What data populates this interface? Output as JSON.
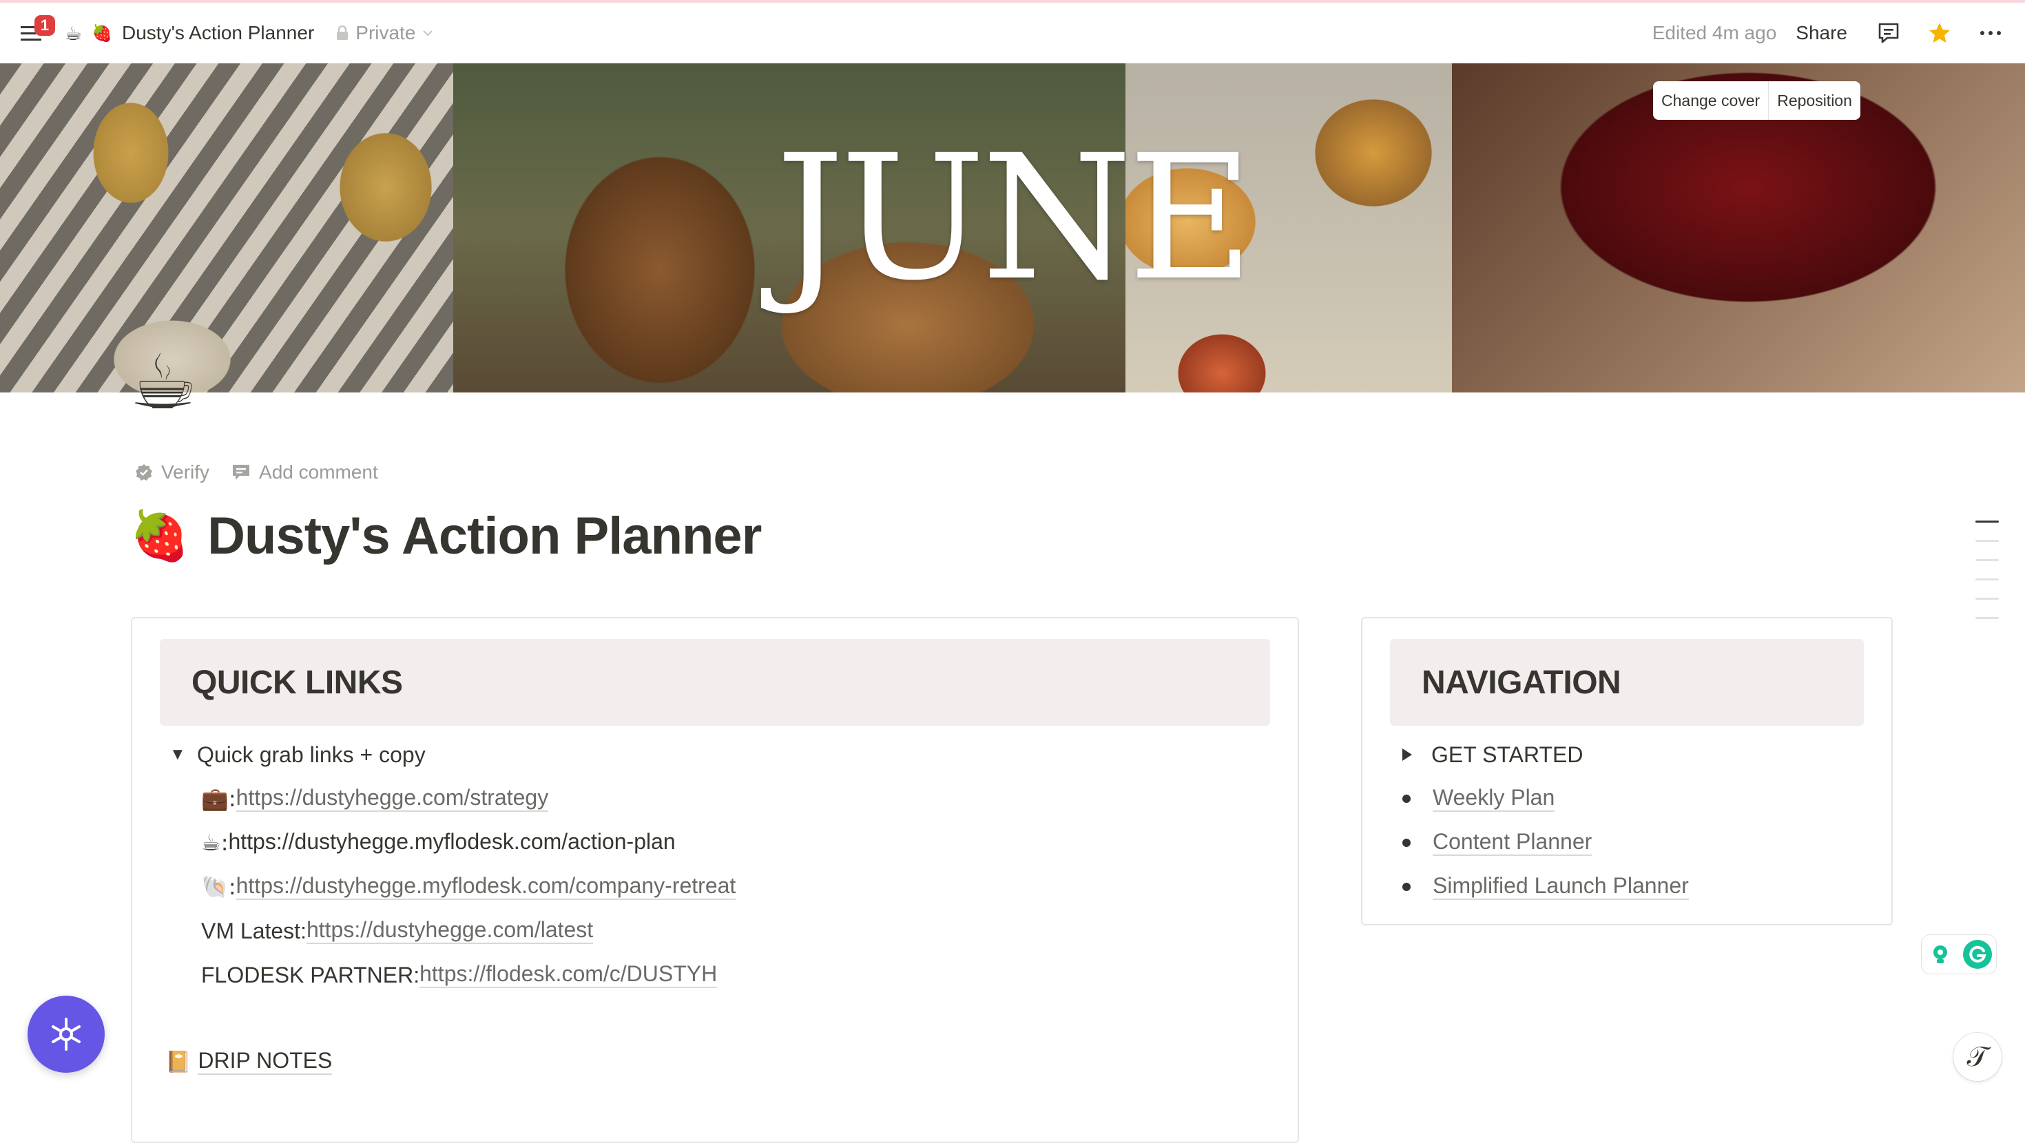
{
  "topbar": {
    "notification_count": "1",
    "breadcrumb_emoji": "☕",
    "page_emoji": "🍓",
    "page_name": "Dusty's Action Planner",
    "privacy": "Private",
    "edited": "Edited 4m ago",
    "share": "Share"
  },
  "cover": {
    "title": "JUNE",
    "change_cover": "Change cover",
    "reposition": "Reposition"
  },
  "page": {
    "icon": "☕",
    "verify": "Verify",
    "add_comment": "Add comment",
    "title_emoji": "🍓",
    "title": "Dusty's Action Planner"
  },
  "quick_links": {
    "heading": "QUICK LINKS",
    "toggle_label": "Quick grab links + copy",
    "links": [
      {
        "prefix": "💼: ",
        "url": "https://dustyhegge.com/strategy"
      },
      {
        "prefix": "☕: ",
        "url": "https://dustyhegge.myflodesk.com/action-plan"
      },
      {
        "prefix": "🐚: ",
        "url": "https://dustyhegge.myflodesk.com/company-retreat"
      },
      {
        "prefix": "VM Latest: ",
        "url": "https://dustyhegge.com/latest"
      },
      {
        "prefix": "FLODESK PARTNER: ",
        "url": "https://flodesk.com/c/DUSTYH"
      }
    ],
    "drip_emoji": "📔",
    "drip_notes": "DRIP NOTES"
  },
  "navigation": {
    "heading": "NAVIGATION",
    "get_started": "GET STARTED",
    "items": [
      "Weekly Plan",
      "Content Planner",
      "Simplified Launch Planner"
    ]
  },
  "colors": {
    "text": "#37352f",
    "muted": "#9b9a97",
    "header_bg": "#f3eded",
    "fab": "#6556e6",
    "badge": "#e03e3e",
    "star": "#f4b400"
  }
}
